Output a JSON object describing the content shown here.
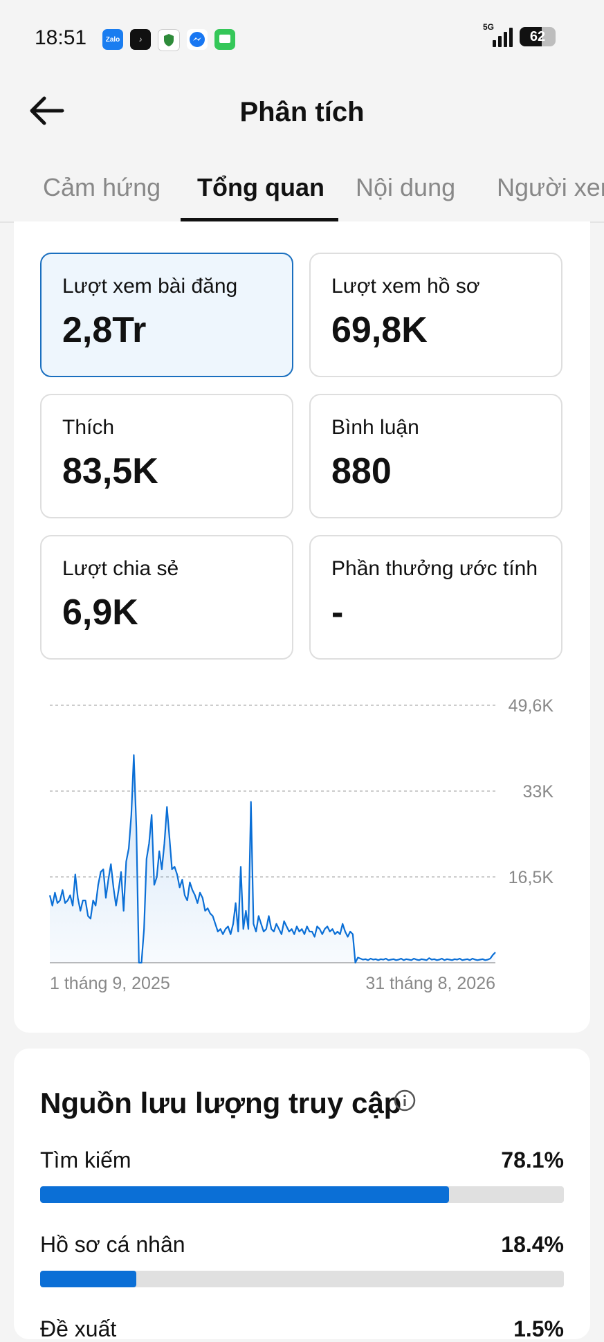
{
  "status_bar": {
    "time": "18:51",
    "network": "5G",
    "battery": "62",
    "app_icons": [
      "zalo-icon",
      "tiktok-icon",
      "shield-icon",
      "messenger-icon",
      "messages-icon"
    ]
  },
  "header": {
    "title": "Phân tích"
  },
  "tabs": [
    {
      "label": "Cảm hứng"
    },
    {
      "label": "Tổng quan",
      "active": true
    },
    {
      "label": "Nội dung"
    },
    {
      "label": "Người xem"
    }
  ],
  "metrics": [
    {
      "label": "Lượt xem bài đăng",
      "value": "2,8Tr",
      "active": true
    },
    {
      "label": "Lượt xem hồ sơ",
      "value": "69,8K"
    },
    {
      "label": "Thích",
      "value": "83,5K"
    },
    {
      "label": "Bình luận",
      "value": "880"
    },
    {
      "label": "Lượt chia sẻ",
      "value": "6,9K"
    },
    {
      "label": "Phần thưởng ước tính",
      "value": "-"
    }
  ],
  "chart_data": {
    "type": "area",
    "y_ticks": [
      "49,6K",
      "33K",
      "16,5K"
    ],
    "x_labels": [
      "1 tháng 9, 2025",
      "31 tháng 8, 2026"
    ],
    "ylim": [
      0,
      49600
    ],
    "grid": true,
    "color": "#0b6fd6",
    "series": [
      {
        "values": [
          13000,
          11000,
          13500,
          11500,
          12000,
          14000,
          11500,
          12000,
          13000,
          11000,
          17000,
          12500,
          10000,
          12000,
          12000,
          9000,
          8500,
          12000,
          11000,
          15000,
          17500,
          18000,
          12500,
          16000,
          19000,
          14500,
          11000,
          14000,
          17500,
          10000,
          19500,
          22000,
          28500,
          40000,
          26000,
          0,
          0,
          6500,
          20000,
          23000,
          28500,
          15000,
          16500,
          21500,
          18000,
          23000,
          30000,
          24000,
          18000,
          18500,
          17000,
          14500,
          16000,
          13000,
          12000,
          15500,
          14000,
          13000,
          11500,
          13500,
          12500,
          10000,
          10500,
          9500,
          9000,
          7500,
          6000,
          6500,
          5500,
          6500,
          7000,
          5500,
          7500,
          11500,
          6000,
          18500,
          6500,
          10000,
          6500,
          31000,
          7500,
          6000,
          9000,
          7500,
          6000,
          6500,
          9000,
          6500,
          6000,
          7500,
          6500,
          5500,
          8000,
          7000,
          6000,
          6500,
          5500,
          7000,
          6000,
          6500,
          5500,
          7000,
          6000,
          6000,
          5000,
          7000,
          6500,
          5500,
          6500,
          7000,
          6000,
          6500,
          5500,
          6000,
          5500,
          7500,
          6000,
          5000,
          6000,
          5500,
          0,
          1000,
          800,
          600,
          700,
          500,
          800,
          600,
          700,
          500,
          700,
          600,
          800,
          500,
          600,
          700,
          500,
          600,
          800,
          500,
          700,
          600,
          500,
          800,
          600,
          500,
          700,
          600,
          500,
          900,
          600,
          700,
          500,
          600,
          800,
          500,
          700,
          600,
          500,
          700,
          600,
          800,
          500,
          600,
          700,
          500,
          800,
          600,
          500,
          600,
          700,
          500,
          600,
          800,
          1500,
          2000
        ]
      }
    ]
  },
  "traffic": {
    "title": "Nguồn lưu lượng truy cập",
    "rows": [
      {
        "label": "Tìm kiếm",
        "pct": "78.1%",
        "value": 78.1
      },
      {
        "label": "Hồ sơ cá nhân",
        "pct": "18.4%",
        "value": 18.4
      },
      {
        "label": "Đề xuất",
        "pct": "1.5%",
        "value": 1.5
      }
    ]
  }
}
